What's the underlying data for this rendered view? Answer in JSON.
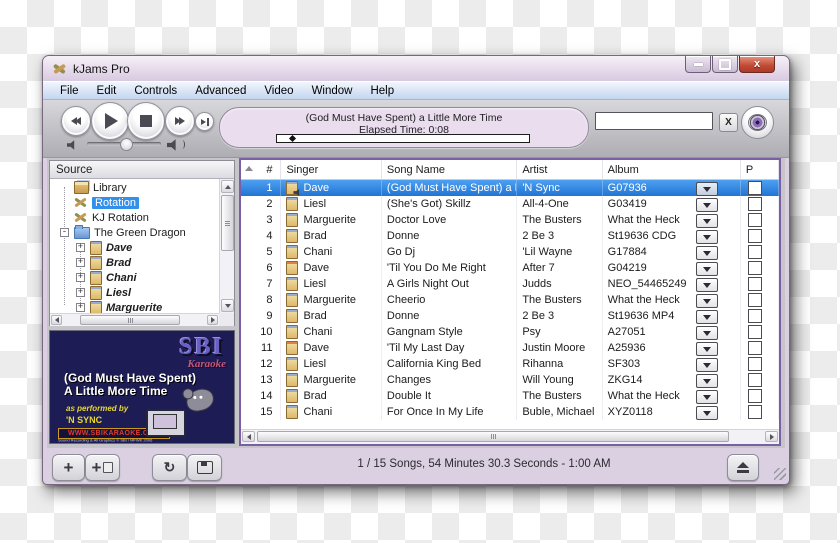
{
  "window": {
    "title": "kJams Pro"
  },
  "menu_bar": {
    "items": [
      "File",
      "Edit",
      "Controls",
      "Advanced",
      "Video",
      "Window",
      "Help"
    ]
  },
  "icons": {
    "app": "crossed-tools",
    "minimize": "bar",
    "maximize": "square",
    "close": "x",
    "rewind": "double-triangle-left",
    "play": "triangle-right",
    "stop": "square",
    "fast_forward": "double-triangle-right",
    "segue": "triangle-bar",
    "volume_low": "speaker",
    "volume_high": "speaker-waves",
    "search_clear": "X",
    "eye": "eye",
    "add": "+",
    "add_playlist": "plus-page",
    "loop": "↻",
    "screen": "monitor",
    "eject": "triangle-over-bar",
    "dropdown": "triangle-down",
    "sort": "triangle-up",
    "expand": "+",
    "collapse": "-"
  },
  "lcd": {
    "title": "(God Must Have Spent) a Little More Time",
    "elapsed_label": "Elapsed Time: 0:08",
    "progress_percent": 5
  },
  "search": {
    "value": "",
    "placeholder": ""
  },
  "source_panel": {
    "title": "Source",
    "items": [
      {
        "label": "Library",
        "icon": "library-icon",
        "level": 1,
        "expander": "none",
        "selected": false,
        "style": "normal"
      },
      {
        "label": "Rotation",
        "icon": "rotation-icon",
        "level": 1,
        "expander": "none",
        "selected": true,
        "style": "normal"
      },
      {
        "label": "KJ Rotation",
        "icon": "rotation-icon",
        "level": 1,
        "expander": "none",
        "selected": false,
        "style": "normal"
      },
      {
        "label": "The Green Dragon",
        "icon": "folder-icon",
        "level": 1,
        "expander": "minus",
        "selected": false,
        "style": "normal"
      },
      {
        "label": "Dave",
        "icon": "singer-icon",
        "level": 2,
        "expander": "plus",
        "selected": false,
        "style": "bold-italic"
      },
      {
        "label": "Brad",
        "icon": "singer-icon",
        "level": 2,
        "expander": "plus",
        "selected": false,
        "style": "bold-italic"
      },
      {
        "label": "Chani",
        "icon": "singer-icon",
        "level": 2,
        "expander": "plus",
        "selected": false,
        "style": "bold-italic"
      },
      {
        "label": "Liesl",
        "icon": "singer-icon",
        "level": 2,
        "expander": "plus",
        "selected": false,
        "style": "bold-italic"
      },
      {
        "label": "Marguerite",
        "icon": "singer-icon",
        "level": 2,
        "expander": "plus",
        "selected": false,
        "style": "bold-italic"
      }
    ]
  },
  "album_art": {
    "logo": "SBI",
    "logo_sub": "Karaoke",
    "title_line1": "(God Must Have Spent)",
    "title_line2": "A Little More Time",
    "credit_label": "as performed by",
    "artist": "'N SYNC",
    "website": "WWW.SBIKARAOKE.COM",
    "fine_print": "Sound Recording & All Graphics © SBI / MFWK 2006"
  },
  "songs_table": {
    "columns": [
      "#",
      "Singer",
      "Song Name",
      "Artist",
      "Album",
      "P"
    ],
    "rows": [
      {
        "num": 1,
        "singer": "Dave",
        "song": "(God Must Have Spent) a L...",
        "artist": "'N Sync",
        "album": "G07936",
        "selected": true,
        "icon": "singer-playing-icon"
      },
      {
        "num": 2,
        "singer": "Liesl",
        "song": "(She's Got) Skillz",
        "artist": "All-4-One",
        "album": "G03419",
        "selected": false,
        "icon": "singer-page-icon"
      },
      {
        "num": 3,
        "singer": "Marguerite",
        "song": "Doctor Love",
        "artist": "The Busters",
        "album": "What the Heck",
        "selected": false,
        "icon": "singer-page-icon"
      },
      {
        "num": 4,
        "singer": "Brad",
        "song": "Donne",
        "artist": "2 Be 3",
        "album": "St19636 CDG",
        "selected": false,
        "icon": "singer-page-icon"
      },
      {
        "num": 5,
        "singer": "Chani",
        "song": "Go Dj",
        "artist": "'Lil Wayne",
        "album": "G17884",
        "selected": false,
        "icon": "singer-page-icon"
      },
      {
        "num": 6,
        "singer": "Dave",
        "song": "'Til You Do Me Right",
        "artist": "After 7",
        "album": "G04219",
        "selected": false,
        "icon": "singer-flag-icon"
      },
      {
        "num": 7,
        "singer": "Liesl",
        "song": "A Girls Night Out",
        "artist": "Judds",
        "album": "NEO_54465249",
        "selected": false,
        "icon": "singer-page-icon"
      },
      {
        "num": 8,
        "singer": "Marguerite",
        "song": "Cheerio",
        "artist": "The Busters",
        "album": "What the Heck",
        "selected": false,
        "icon": "singer-page-icon"
      },
      {
        "num": 9,
        "singer": "Brad",
        "song": "Donne",
        "artist": "2 Be 3",
        "album": "St19636 MP4",
        "selected": false,
        "icon": "singer-page-icon"
      },
      {
        "num": 10,
        "singer": "Chani",
        "song": "Gangnam Style",
        "artist": "Psy",
        "album": "A27051",
        "selected": false,
        "icon": "singer-page-icon"
      },
      {
        "num": 11,
        "singer": "Dave",
        "song": "'Til My Last Day",
        "artist": "Justin Moore",
        "album": "A25936",
        "selected": false,
        "icon": "singer-flag-icon"
      },
      {
        "num": 12,
        "singer": "Liesl",
        "song": "California King Bed",
        "artist": "Rihanna",
        "album": "SF303",
        "selected": false,
        "icon": "singer-page-icon"
      },
      {
        "num": 13,
        "singer": "Marguerite",
        "song": "Changes",
        "artist": "Will Young",
        "album": "ZKG14",
        "selected": false,
        "icon": "singer-page-icon"
      },
      {
        "num": 14,
        "singer": "Brad",
        "song": "Double It",
        "artist": "The Busters",
        "album": "What the Heck",
        "selected": false,
        "icon": "singer-page-icon"
      },
      {
        "num": 15,
        "singer": "Chani",
        "song": "For Once In My Life",
        "artist": "Buble, Michael",
        "album": "XYZ0118",
        "selected": false,
        "icon": "singer-page-icon"
      }
    ]
  },
  "status_bar": {
    "text": "1 / 15 Songs, 54 Minutes 30.3 Seconds - 1:00 AM"
  },
  "colors": {
    "selection_blue": "#2f86e0",
    "table_border_purple": "#7a5fa5",
    "window_frame": "#dbd0e2",
    "close_button_red": "#c14a36",
    "album_art_bg": "#1e1c55",
    "accent_yellow": "#e8d82c"
  }
}
